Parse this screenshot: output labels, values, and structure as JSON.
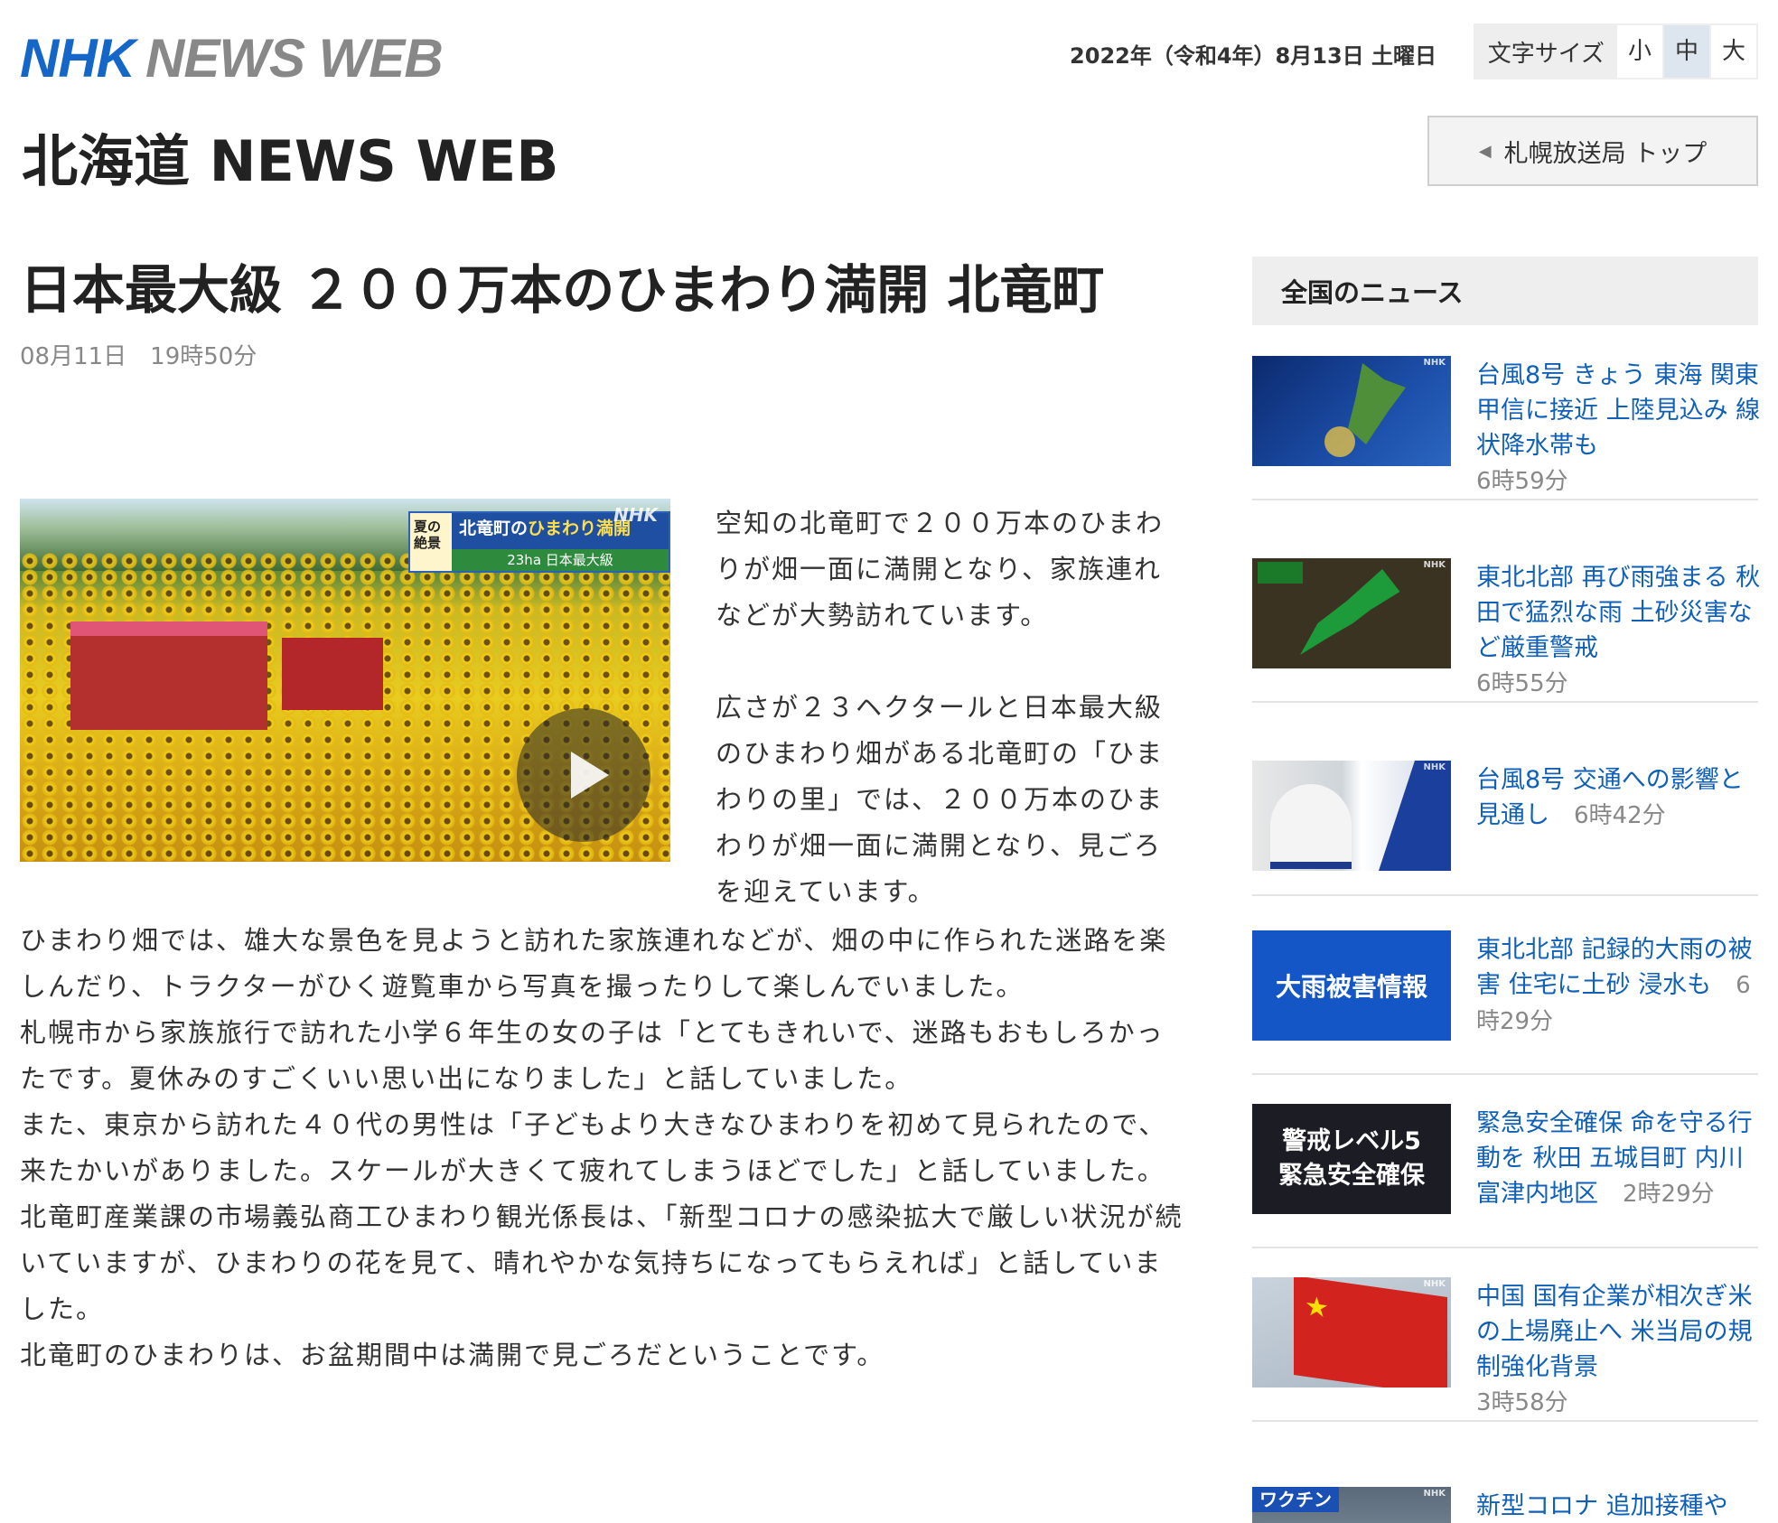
{
  "header": {
    "logo_nhk": "NHK",
    "logo_newsweb": "NEWS WEB",
    "date": "2022年（令和4年）8月13日 土曜日",
    "font_size_label": "文字サイズ",
    "font_size_options": [
      "小",
      "中",
      "大"
    ],
    "font_size_selected": "中"
  },
  "subsite": {
    "title": "北海道 NEWS WEB",
    "top_button": "札幌放送局 トップ"
  },
  "article": {
    "headline": "日本最大級 ２００万本のひまわり満開 北竜町",
    "published": "08月11日　19時50分",
    "video": {
      "badge_left": "夏の絶景",
      "badge_title_pre": "北竜町の",
      "badge_title_hl": "ひまわり満開",
      "badge_sub": "23ha 日本最大級",
      "watermark": "NHK"
    },
    "lead_paragraphs": [
      "空知の北竜町で２００万本のひまわりが畑一面に満開となり、家族連れなどが大勢訪れています。",
      "広さが２３ヘクタールと日本最大級のひまわり畑がある北竜町の「ひまわりの里」では、２００万本のひまわりが畑一面に満開となり、見ごろを迎えています。"
    ],
    "body_paragraphs": [
      "ひまわり畑では、雄大な景色を見ようと訪れた家族連れなどが、畑の中に作られた迷路を楽しんだり、トラクターがひく遊覧車から写真を撮ったりして楽しんでいました。",
      "札幌市から家族旅行で訪れた小学６年生の女の子は「とてもきれいで、迷路もおもしろかったです。夏休みのすごくいい思い出になりました」と話していました。",
      "また、東京から訪れた４０代の男性は「子どもより大きなひまわりを初めて見られたので、来たかいがありました。スケールが大きくて疲れてしまうほどでした」と話していました。",
      "北竜町産業課の市場義弘商工ひまわり観光係長は、「新型コロナの感染拡大で厳しい状況が続いていますが、ひまわりの花を見て、晴れやかな気持ちになってもらえれば」と話していました。",
      "北竜町のひまわりは、お盆期間中は満開で見ごろだということです。"
    ]
  },
  "sidebar": {
    "heading": "全国のニュース",
    "items": [
      {
        "title": "台風8号 きょう 東海 関東甲信に接近 上陸見込み 線状降水帯も",
        "time": "6時59分",
        "thumb": "typhoon-map"
      },
      {
        "title": "東北北部 再び雨強まる 秋田で猛烈な雨 土砂災害など厳重警戒",
        "time": "6時55分",
        "thumb": "radar-map"
      },
      {
        "title": "台風8号 交通への影響と見通し",
        "time": "6時42分",
        "thumb": "train-plane"
      },
      {
        "title": "東北北部 記録的大雨の被害 住宅に土砂 浸水も",
        "time": "6時29分",
        "thumb_text": "大雨被害情報"
      },
      {
        "title": "緊急安全確保 命を守る行動を 秋田 五城目町 内川 富津内地区",
        "time": "2時29分",
        "thumb_text_1": "警戒レベル5",
        "thumb_text_2": "緊急安全確保"
      },
      {
        "title": "中国 国有企業が相次ぎ米の上場廃止へ 米当局の規制強化背景",
        "time": "3時58分",
        "thumb": "china-flag"
      },
      {
        "title": "新型コロナ 追加接種や",
        "time": "",
        "thumb_text": "ワクチン"
      }
    ],
    "thumb_watermark": "NHK"
  },
  "colors": {
    "link": "#1060b8",
    "logo_blue": "#1466c8",
    "logo_gray": "#888888"
  }
}
